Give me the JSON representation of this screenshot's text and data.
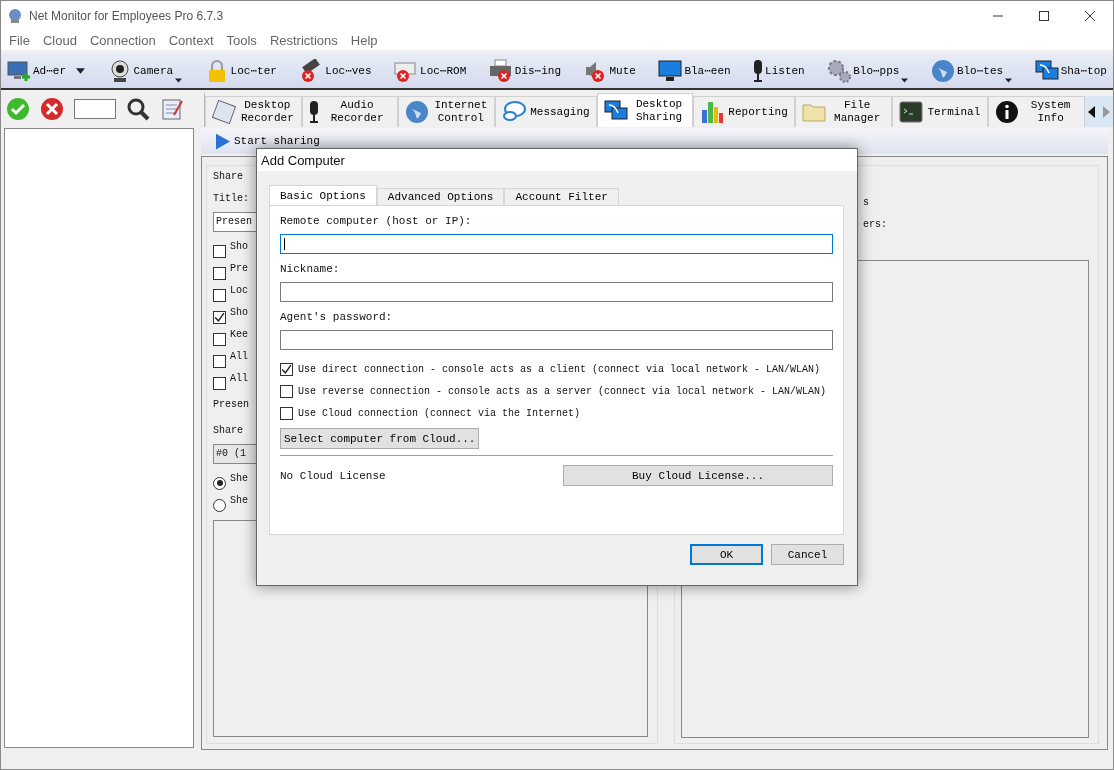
{
  "window": {
    "title": "Net Monitor for Employees Pro 6.7.3"
  },
  "menu": [
    "File",
    "Cloud",
    "Connection",
    "Context",
    "Tools",
    "Restrictions",
    "Help"
  ],
  "toolbar": [
    {
      "label": "Ad⋯er",
      "dropdown": true
    },
    {
      "label": "Camera",
      "dropdown": true
    },
    {
      "label": "Loc⋯ter",
      "dropdown": false
    },
    {
      "label": "Loc⋯ves",
      "dropdown": false
    },
    {
      "label": "Loc⋯ROM",
      "dropdown": false
    },
    {
      "label": "Dis⋯ing",
      "dropdown": false
    },
    {
      "label": "Mute",
      "dropdown": false
    },
    {
      "label": "Bla⋯een",
      "dropdown": false
    },
    {
      "label": "Listen",
      "dropdown": false
    },
    {
      "label": "Blo⋯pps",
      "dropdown": true
    },
    {
      "label": "Blo⋯tes",
      "dropdown": true
    },
    {
      "label": "Sha⋯top",
      "dropdown": false
    }
  ],
  "tabs": [
    {
      "label": "Desktop Recorder",
      "selected": false
    },
    {
      "label": "Audio Recorder",
      "selected": false
    },
    {
      "label": "Internet Control",
      "selected": false
    },
    {
      "label": "Messaging",
      "selected": false
    },
    {
      "label": "Desktop Sharing",
      "selected": true
    },
    {
      "label": "Reporting",
      "selected": false
    },
    {
      "label": "File Manager",
      "selected": false
    },
    {
      "label": "Terminal",
      "selected": false
    },
    {
      "label": "System Info",
      "selected": false
    }
  ],
  "sharing_toolbar": [
    {
      "label": "Start sharing",
      "disabled": false
    }
  ],
  "share_panel": {
    "legend": "Share",
    "title_label": "Title:",
    "title_value": "Presen",
    "options": [
      {
        "label": "Sho",
        "checked": false
      },
      {
        "label": "Pre",
        "checked": false
      },
      {
        "label": "Loc",
        "checked": false
      },
      {
        "label": "Sho",
        "checked": true
      },
      {
        "label": "Kee",
        "checked": false
      },
      {
        "label": "All",
        "checked": false
      },
      {
        "label": "All",
        "checked": false
      }
    ],
    "presentation_label": "Presen",
    "share_label": "Share",
    "screen_value": "#0 (1",
    "radios": [
      {
        "label": "She",
        "selected": true
      },
      {
        "label": "She",
        "selected": false
      }
    ]
  },
  "right_panel": {
    "lines": [
      "s",
      "ers:"
    ]
  },
  "dialog": {
    "title": "Add Computer",
    "tabs": [
      {
        "label": "Basic Options",
        "selected": true
      },
      {
        "label": "Advanced Options",
        "selected": false
      },
      {
        "label": "Account Filter",
        "selected": false
      }
    ],
    "fields": [
      {
        "label": "Remote computer (host or IP):",
        "focused": true
      },
      {
        "label": "Nickname:",
        "focused": false
      },
      {
        "label": "Agent's password:",
        "focused": false
      }
    ],
    "options": [
      {
        "label": "Use direct connection - console acts as a client (connect via local network - LAN/WLAN)",
        "checked": true
      },
      {
        "label": "Use reverse connection - console acts as a server (connect via local network - LAN/WLAN)",
        "checked": false
      },
      {
        "label": "Use Cloud connection (connect via the Internet)",
        "checked": false
      }
    ],
    "select_button": "Select computer from Cloud...",
    "license_status": "No Cloud License",
    "buy_button": "Buy Cloud License...",
    "buttons": [
      {
        "label": "OK",
        "default": true
      },
      {
        "label": "Cancel",
        "default": false
      }
    ]
  }
}
